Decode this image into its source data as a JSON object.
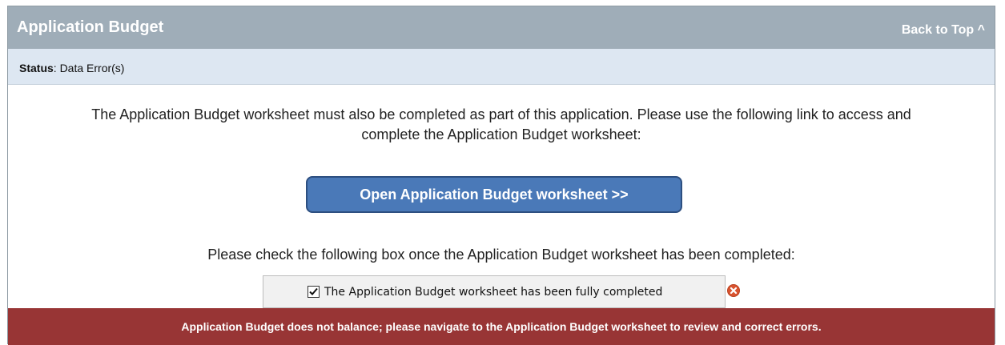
{
  "header": {
    "title": "Application Budget",
    "back_to_top": "Back to Top ^"
  },
  "status": {
    "label": "Status",
    "value": ": Data Error(s)"
  },
  "intro": {
    "line1": "The Application Budget worksheet must also be completed as part of this application.  Please use the following link to access and",
    "line2": "complete the Application Budget worksheet:"
  },
  "open_button": {
    "label": "Open Application Budget worksheet >>"
  },
  "checkbox_prompt": "Please check the following box once the Application Budget worksheet has been completed:",
  "checkbox": {
    "label": "The Application Budget worksheet has been fully completed",
    "checked": true
  },
  "error": {
    "icon": "error-x-icon",
    "message": "Application Budget does not balance; please navigate to the Application Budget worksheet to review and correct errors."
  },
  "colors": {
    "header_bg": "#9fadb8",
    "status_bg": "#dde7f2",
    "button_bg": "#4a79b8",
    "error_bg": "#983535",
    "error_icon": "#d9532f"
  }
}
